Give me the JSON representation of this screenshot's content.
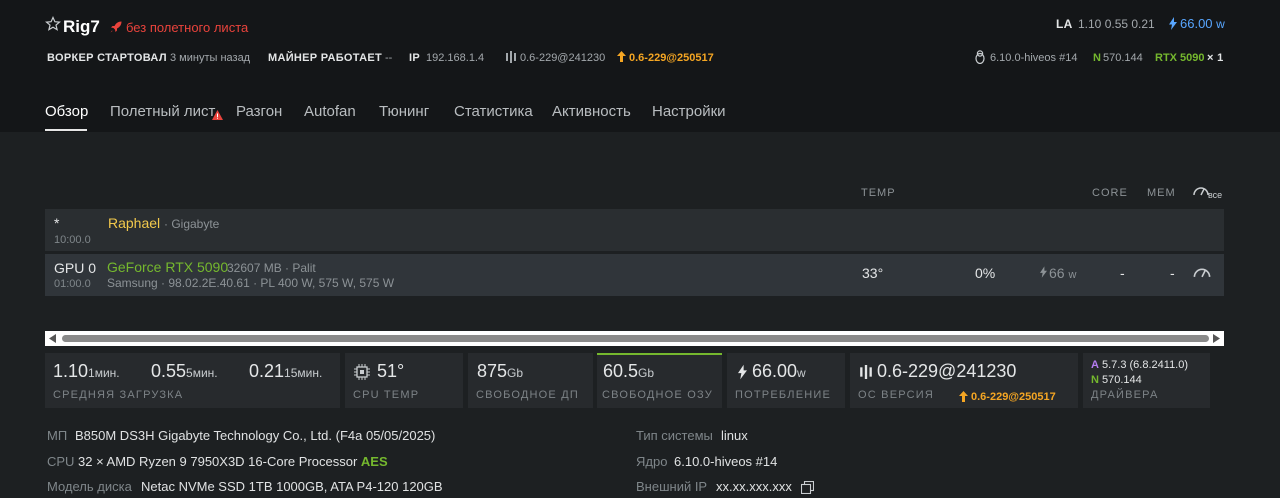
{
  "header": {
    "rig_name": "Rig7",
    "flight_sheet_status": "без полетного листа",
    "la_label": "LA",
    "la_values": "1.10 0.55 0.21",
    "power": "66.00",
    "power_unit": "w"
  },
  "status": {
    "worker_label": "ВОРКЕР СТАРТОВАЛ",
    "worker_value": "3 минуты назад",
    "miner_label": "МАЙНЕР РАБОТАЕТ",
    "miner_value": "--",
    "ip_label": "IP",
    "ip_value": "192.168.1.4",
    "version": "0.6-229@241230",
    "version_update": "0.6-229@250517",
    "kernel": "6.10.0-hiveos #14",
    "nvidia_badge": "N",
    "nvidia_driver": "570.144",
    "gpu_model": "RTX 5090",
    "gpu_count": "× 1"
  },
  "tabs": [
    "Обзор",
    "Полетный лист",
    "Разгон",
    "Autofan",
    "Тюнинг",
    "Статистика",
    "Активность",
    "Настройки"
  ],
  "table": {
    "headers": {
      "temp": "TEMP",
      "core": "CORE",
      "mem": "MEM",
      "all": "все"
    },
    "cpu_row": {
      "star": "*",
      "pci": "10:00.0",
      "name": "Raphael",
      "vendor": "· Gigabyte"
    },
    "gpu_row": {
      "label": "GPU 0",
      "pci": "01:00.0",
      "name": "GeForce RTX 5090",
      "details": "32607 MB · Palit",
      "subdetails": "Samsung · 98.02.2E.40.61 · PL 400 W, 575 W, 575 W",
      "temp": "33°",
      "fan": "0%",
      "power": "66",
      "power_unit": "w",
      "core": "-",
      "mem": "-"
    }
  },
  "stats": {
    "la1": "1.10",
    "la1_unit": "1мин.",
    "la5": "0.55",
    "la5_unit": "5мин.",
    "la15": "0.21",
    "la15_unit": "15мин.",
    "la_caption": "СРЕДНЯЯ ЗАГРУЗКА",
    "cpu_temp": "51°",
    "cpu_temp_caption": "CPU TEMP",
    "disk_free": "875",
    "disk_unit": "Gb",
    "disk_caption": "СВОБОДНОЕ ДП",
    "ram_free": "60.5",
    "ram_unit": "Gb",
    "ram_caption": "СВОБОДНОЕ ОЗУ",
    "power": "66.00",
    "power_unit": "w",
    "power_caption": "ПОТРЕБЛЕНИЕ",
    "os_version": "0.6-229@241230",
    "os_caption": "ОС ВЕРСИЯ",
    "os_update": "0.6-229@250517",
    "amd_badge": "A",
    "amd_driver": "5.7.3 (6.8.2411.0)",
    "nv_badge": "N",
    "nv_driver": "570.144",
    "drivers_caption": "ДРАЙВЕРА"
  },
  "system_info": {
    "mb_label": "МП",
    "mb_value": "B850M DS3H Gigabyte Technology Co., Ltd. (F4a 05/05/2025)",
    "cpu_label": "CPU",
    "cpu_value": "32 × AMD Ryzen 9 7950X3D 16-Core Processor",
    "cpu_aes": "AES",
    "disk_label": "Модель диска",
    "disk_value": "Netac NVMe SSD 1TB 1000GB, ATA P4-120 120GB",
    "systype_label": "Тип системы",
    "systype_value": "linux",
    "kernel_label": "Ядро",
    "kernel_value": "6.10.0-hiveos #14",
    "extip_label": "Внешний IP",
    "extip_value": "xx.xx.xxx.xxx"
  },
  "colors": {
    "accent_green": "#75b82e",
    "warning_red": "#e9433c",
    "update_orange": "#f5a623",
    "power_blue": "#58a6ff",
    "cpu_yellow": "#f2c94c",
    "amd_purple": "#b57cf2"
  }
}
